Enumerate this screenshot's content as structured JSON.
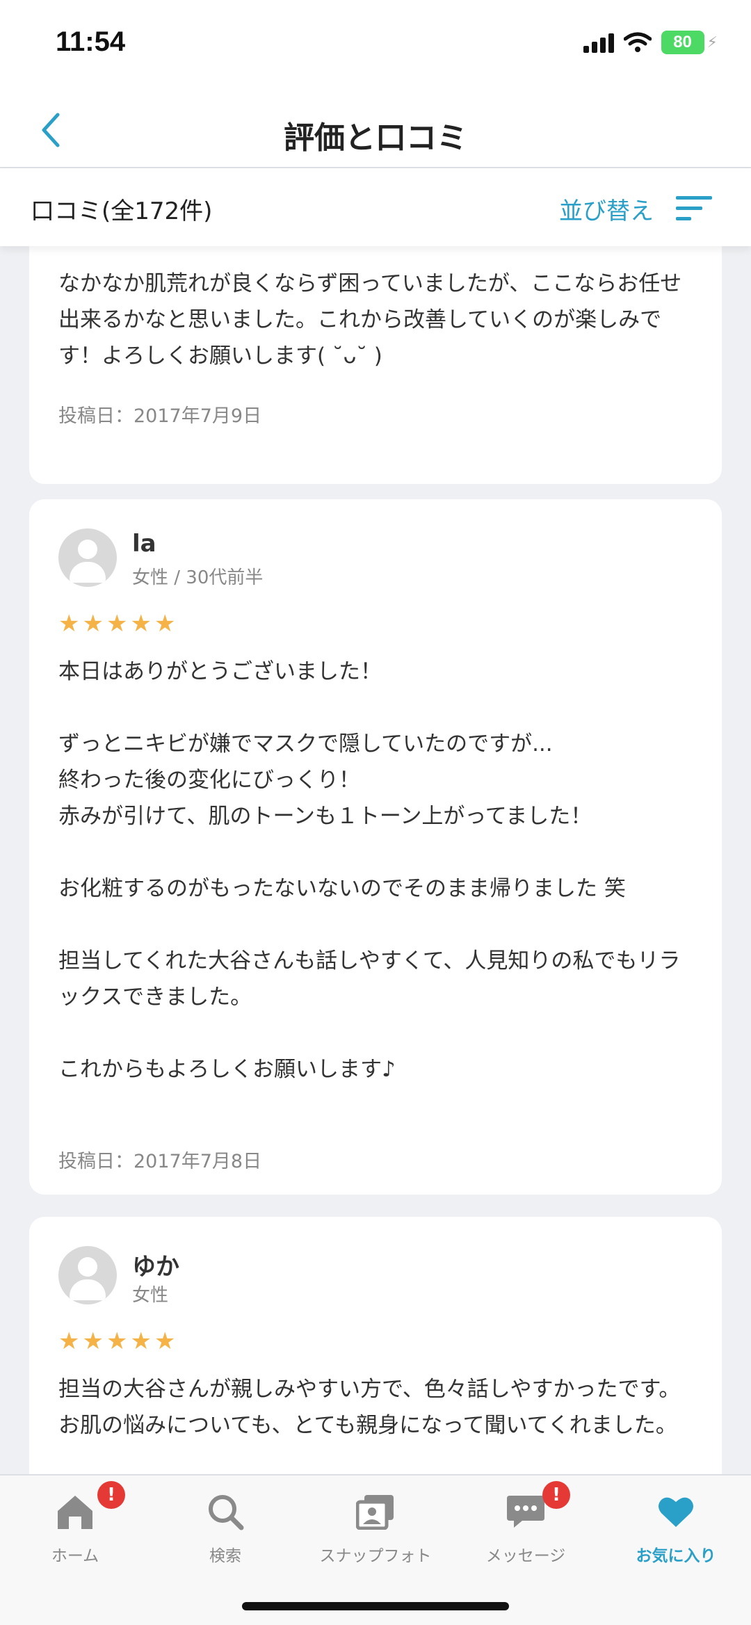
{
  "status_bar": {
    "time": "11:54",
    "battery": "80"
  },
  "nav": {
    "title": "評価と口コミ"
  },
  "subheader": {
    "count_label": "口コミ(全172件)",
    "sort_label": "並び替え"
  },
  "reviews": [
    {
      "text": "なかなか肌荒れが良くならず困っていましたが、ここならお任せ出来るかなと思いました。これから改善していくのが楽しみです！よろしくお願いします( ˘ᴗ˘ )",
      "date": "投稿日：2017年7月9日"
    },
    {
      "name": "la",
      "meta": "女性 / 30代前半",
      "rating": 5,
      "text": "本日はありがとうございました！\n\nずっとニキビが嫌でマスクで隠していたのですが...\n終わった後の変化にびっくり！\n赤みが引けて、肌のトーンも１トーン上がってました！\n\nお化粧するのがもったないないのでそのまま帰りました 笑\n\n担当してくれた大谷さんも話しやすくて、人見知りの私でもリラックスできました。\n\nこれからもよろしくお願いします♪",
      "date": "投稿日：2017年7月8日"
    },
    {
      "name": "ゆか",
      "meta": "女性",
      "rating": 5,
      "text": "担当の大谷さんが親しみやすい方で、色々話しやすかったです。お肌の悩みについても、とても親身になって聞いてくれました。"
    }
  ],
  "tabs": [
    {
      "label": "ホーム",
      "icon": "home-icon",
      "badge": "!"
    },
    {
      "label": "検索",
      "icon": "search-icon"
    },
    {
      "label": "スナップフォト",
      "icon": "snap-photo-icon"
    },
    {
      "label": "メッセージ",
      "icon": "message-icon",
      "badge": "!"
    },
    {
      "label": "お気に入り",
      "icon": "heart-icon",
      "active": true
    }
  ],
  "colors": {
    "accent": "#2aa0c8",
    "star": "#f5b347",
    "badge": "#e53935"
  }
}
